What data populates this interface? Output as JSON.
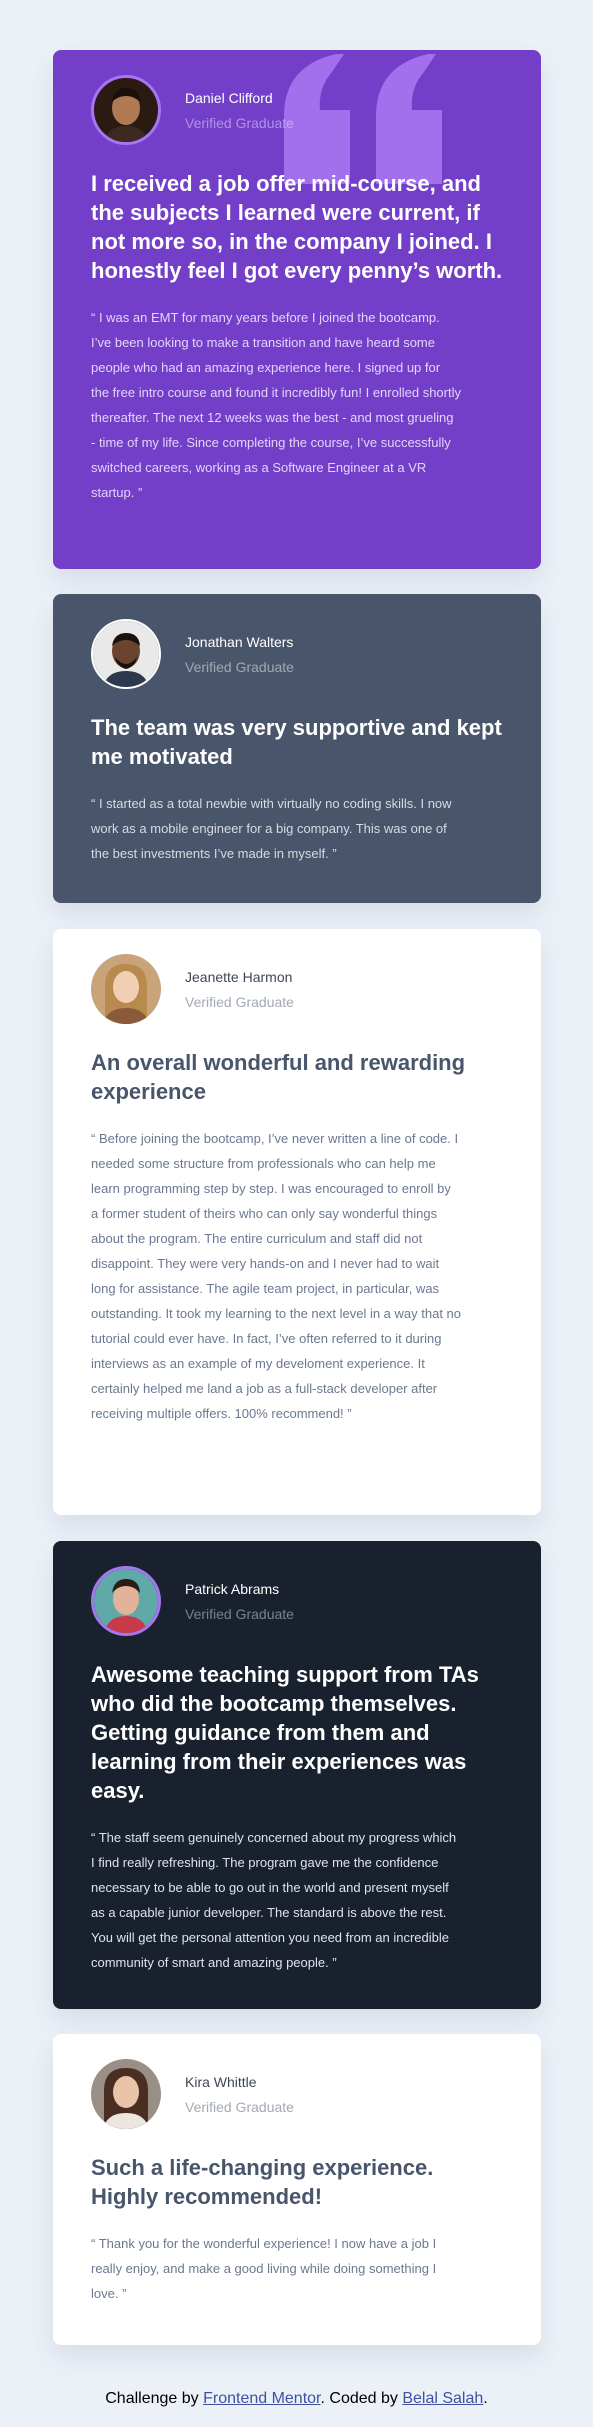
{
  "testimonials": [
    {
      "name": "Daniel Clifford",
      "role": "Verified Graduate",
      "headline": "I received a job offer mid-course, and the subjects I learned were current, if not more so, in the company I joined. I honestly feel I got every penny’s worth.",
      "quote": "“ I was an EMT for many years before I joined the bootcamp. I’ve been looking to make a transition and have heard some people who had an amazing experience here. I signed up for the free intro course and found it incredibly fun! I enrolled shortly thereafter. The next 12 weeks was the best - and most grueling - time of my life. Since completing the course, I’ve successfully switched careers, working as a Software Engineer at a VR startup. ”",
      "background": "#733fc8"
    },
    {
      "name": "Jonathan Walters",
      "role": "Verified Graduate",
      "headline": "The team was very supportive and kept me motivated",
      "quote": "“ I started as a total newbie with virtually no coding skills. I now work as a mobile engineer for a big company. This was one of the best investments I’ve made in myself. ”",
      "background": "#48556a"
    },
    {
      "name": "Jeanette Harmon",
      "role": "Verified Graduate",
      "headline": "An overall wonderful and rewarding experience",
      "quote": "“ Before joining the bootcamp, I’ve never written a line of code. I needed some structure from professionals who can help me learn programming step by step. I was encouraged to enroll by a former student of theirs who can only say wonderful things about the program. The entire curriculum and staff did not disappoint. They were very hands-on and I never had to wait long for assistance. The agile team project, in particular, was outstanding. It took my learning to the next level in a way that no tutorial could ever have. In fact, I’ve often referred to it during interviews as an example of my develoment experience. It certainly helped me land a job as a full-stack developer after receiving multiple offers. 100% recommend! ”",
      "background": "#ffffff"
    },
    {
      "name": "Patrick Abrams",
      "role": "Verified Graduate",
      "headline": "Awesome teaching support from TAs who did the bootcamp themselves. Getting guidance from them and learning from their experiences was easy.",
      "quote": "“ The staff seem genuinely concerned about my progress which I find really refreshing. The program gave me the confidence necessary to be able to go out in the world and present myself as a capable junior developer. The standard is above the rest. You will get the personal attention you need from an incredible community of smart and amazing people. ”",
      "background": "#19212e"
    },
    {
      "name": "Kira Whittle",
      "role": "Verified Graduate",
      "headline": "Such a life-changing experience. Highly recommended!",
      "quote": "“ Thank you for the wonderful experience! I now have a job I really enjoy, and make a good living while doing something I love. ”",
      "background": "#ffffff"
    }
  ],
  "icons": {
    "quote_mark": "quote-mark-icon",
    "avatar": "avatar-photo"
  },
  "attribution": {
    "prefix": "Challenge by ",
    "challenge_link": "Frontend Mentor",
    "middle": ". Coded by ",
    "author_link": "Belal Salah",
    "suffix": "."
  },
  "colors": {
    "page_background": "#ecf1f8",
    "link": "#3e52a3",
    "quote_mark": "#a775f1"
  }
}
